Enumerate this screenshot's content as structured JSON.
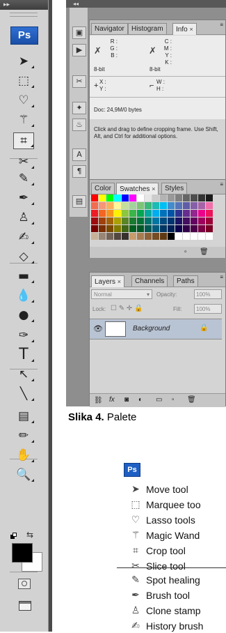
{
  "toolbox": {
    "ps_label": "Ps",
    "tools": [
      {
        "name": "move-tool-icon",
        "glyph": "➤"
      },
      {
        "name": "marquee-tool-icon",
        "glyph": "⬚"
      },
      {
        "name": "lasso-tool-icon",
        "glyph": "♡"
      },
      {
        "name": "magic-wand-icon",
        "glyph": "⚚"
      },
      {
        "name": "crop-tool-icon",
        "glyph": "⌗"
      },
      {
        "name": "slice-tool-icon",
        "glyph": "✂"
      },
      {
        "name": "spot-healing-icon",
        "glyph": "✎"
      },
      {
        "name": "brush-tool-icon",
        "glyph": "✒"
      },
      {
        "name": "clone-stamp-icon",
        "glyph": "♙"
      },
      {
        "name": "history-brush-icon",
        "glyph": "✍"
      },
      {
        "name": "eraser-tool-icon",
        "glyph": "◇"
      },
      {
        "name": "gradient-tool-icon",
        "glyph": "▬"
      },
      {
        "name": "blur-tool-icon",
        "glyph": "💧"
      },
      {
        "name": "dodge-tool-icon",
        "glyph": "●"
      },
      {
        "name": "pen-tool-icon",
        "glyph": "✑"
      },
      {
        "name": "type-tool-icon",
        "glyph": "T"
      },
      {
        "name": "path-selection-icon",
        "glyph": "↖"
      },
      {
        "name": "line-tool-icon",
        "glyph": "╲"
      },
      {
        "name": "notes-tool-icon",
        "glyph": "▤"
      },
      {
        "name": "eyedropper-tool-icon",
        "glyph": "✏"
      },
      {
        "name": "hand-tool-icon",
        "glyph": "✋"
      },
      {
        "name": "zoom-tool-icon",
        "glyph": "🔍"
      }
    ]
  },
  "panels": {
    "info": {
      "tabs": [
        "Navigator",
        "Histogram",
        "Info"
      ],
      "r": "R :",
      "g": "G :",
      "b": "B :",
      "c": "C :",
      "m": "M :",
      "y": "Y :",
      "k": "K :",
      "bit_left": "8-bit",
      "bit_right": "8-bit",
      "x": "X :",
      "yy": "Y :",
      "w": "W :",
      "h": "H :",
      "doc": "Doc: 24,9M/0 bytes",
      "hint": "Click and drag to define cropping frame. Use Shift, Alt, and Ctrl for additional options."
    },
    "color": {
      "tabs": [
        "Color",
        "Swatches",
        "Styles"
      ]
    },
    "layers": {
      "tabs": [
        "Layers",
        "Channels",
        "Paths"
      ],
      "blend_mode": "Normal",
      "opacity_label": "Opacity:",
      "opacity_value": "100%",
      "lock_label": "Lock:",
      "fill_label": "Fill:",
      "fill_value": "100%",
      "layer_name": "Background"
    }
  },
  "caption": {
    "bold": "Slika 4.",
    "text": " Palete"
  },
  "list": {
    "ps_label": "Ps",
    "items": [
      "Move tool",
      "Marquee too",
      "Lasso tools",
      "Magic Wand",
      "Crop tool",
      "Slice tool",
      "Spot healing",
      "Brush tool",
      "Clone stamp",
      "History brush"
    ]
  }
}
